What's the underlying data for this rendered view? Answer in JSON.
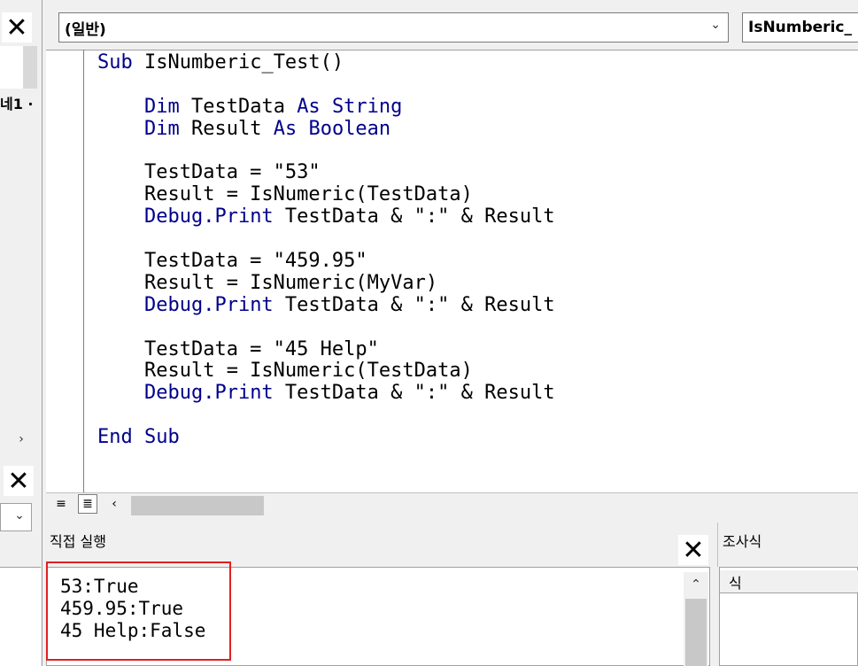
{
  "window": {
    "procedure_combo": "(일반)",
    "member_combo": "IsNumberic_"
  },
  "left_panel": {
    "close_label": "✕",
    "tree_fragment": "네1 ·",
    "expand_arrow": "›",
    "close2_label": "✕",
    "dropdown_arrow": "⌄"
  },
  "code": {
    "lines": [
      [
        {
          "t": "Sub",
          "k": true
        },
        {
          "t": " IsNumberic_Test()"
        }
      ],
      [],
      [
        {
          "t": "    "
        },
        {
          "t": "Dim",
          "k": true
        },
        {
          "t": " TestData "
        },
        {
          "t": "As",
          "k": true
        },
        {
          "t": " "
        },
        {
          "t": "String",
          "k": true
        }
      ],
      [
        {
          "t": "    "
        },
        {
          "t": "Dim",
          "k": true
        },
        {
          "t": " Result "
        },
        {
          "t": "As",
          "k": true
        },
        {
          "t": " "
        },
        {
          "t": "Boolean",
          "k": true
        }
      ],
      [],
      [
        {
          "t": "    TestData = \"53\""
        }
      ],
      [
        {
          "t": "    Result = IsNumeric(TestData)"
        }
      ],
      [
        {
          "t": "    "
        },
        {
          "t": "Debug.Print",
          "k": true
        },
        {
          "t": " TestData & \":\" & Result"
        }
      ],
      [],
      [
        {
          "t": "    TestData = \"459.95\""
        }
      ],
      [
        {
          "t": "    Result = IsNumeric(MyVar)"
        }
      ],
      [
        {
          "t": "    "
        },
        {
          "t": "Debug.Print",
          "k": true
        },
        {
          "t": " TestData & \":\" & Result"
        }
      ],
      [],
      [
        {
          "t": "    TestData = \"45 Help\""
        }
      ],
      [
        {
          "t": "    Result = IsNumeric(TestData)"
        }
      ],
      [
        {
          "t": "    "
        },
        {
          "t": "Debug.Print",
          "k": true
        },
        {
          "t": " TestData & \":\" & Result"
        }
      ],
      [],
      [
        {
          "t": "End Sub",
          "k": true
        }
      ]
    ]
  },
  "immediate": {
    "title": "직접 실행",
    "close_label": "✕",
    "output": [
      "53:True",
      "459.95:True",
      "45 Help:False"
    ],
    "scroll_up": "⌃"
  },
  "watch": {
    "title": "조사식",
    "column_header": "식"
  },
  "bottom_bar": {
    "left_arrow": "‹"
  },
  "colors": {
    "keyword": "#00008b",
    "highlight_box": "#e02020"
  }
}
